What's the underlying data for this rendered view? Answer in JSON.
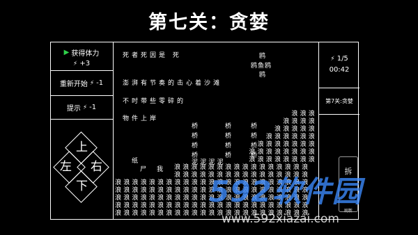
{
  "title": "第七关：贪婪",
  "left_panel": {
    "gain_stamina": "获得体力",
    "gain_amount": "+3",
    "restart_label": "重新开始",
    "restart_cost": "-1",
    "hint_label": "提示",
    "hint_cost": "-1"
  },
  "dpad": {
    "up": "上",
    "down": "下",
    "left": "左",
    "right": "右"
  },
  "right_panel": {
    "stamina": "1/5",
    "timer": "00:42",
    "level_name": "第7关:贪婪",
    "action_label": "拆",
    "action_sub": "刷新"
  },
  "story": {
    "line1": "死者死因是 死",
    "line2": "澎湃有节奏的击心着沙滩",
    "line3": "不时带些零碎的",
    "line4": "物件上岸",
    "bird1": "鸥",
    "bird_fish": "鸥鱼鸥",
    "bird2": "鸥"
  },
  "scene": {
    "paper": "纸",
    "corpse": "尸",
    "me": "我",
    "bridge": "桥",
    "wave": "浪",
    "ground": "泥"
  },
  "watermark": {
    "brand": "592软件园",
    "url": "www.592xiazai.com"
  }
}
